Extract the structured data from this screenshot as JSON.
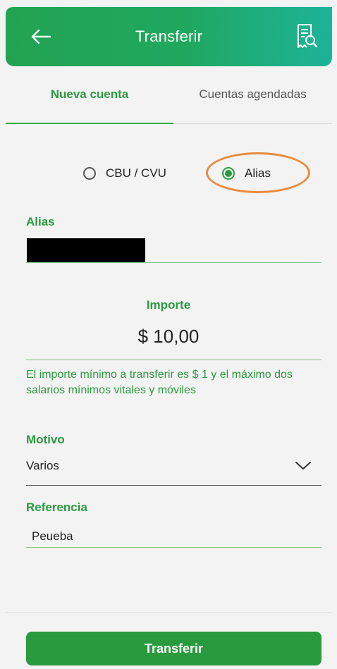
{
  "header": {
    "title": "Transferir",
    "back_icon": "arrow-left-icon",
    "action_icon": "receipt-search-icon"
  },
  "tabs": [
    {
      "label": "Nueva cuenta",
      "active": true
    },
    {
      "label": "Cuentas agendadas",
      "active": false
    }
  ],
  "account_type": {
    "options": [
      {
        "label": "CBU / CVU",
        "selected": false
      },
      {
        "label": "Alias",
        "selected": true
      }
    ]
  },
  "alias": {
    "label": "Alias",
    "value_redacted": true
  },
  "amount": {
    "label": "Importe",
    "value": "$ 10,00"
  },
  "info": {
    "text": "El importe mínimo a transferir es $ 1 y  el máximo dos salarios mínimos vitales y móviles"
  },
  "reason": {
    "label": "Motivo",
    "selected": "Varios"
  },
  "reference": {
    "label": "Referencia",
    "value": "Peueba"
  },
  "submit": {
    "label": "Transferir"
  },
  "colors": {
    "brand_green": "#2a9a3e",
    "header_gradient_end": "#1db39a",
    "highlight_orange": "#e98b3d"
  }
}
